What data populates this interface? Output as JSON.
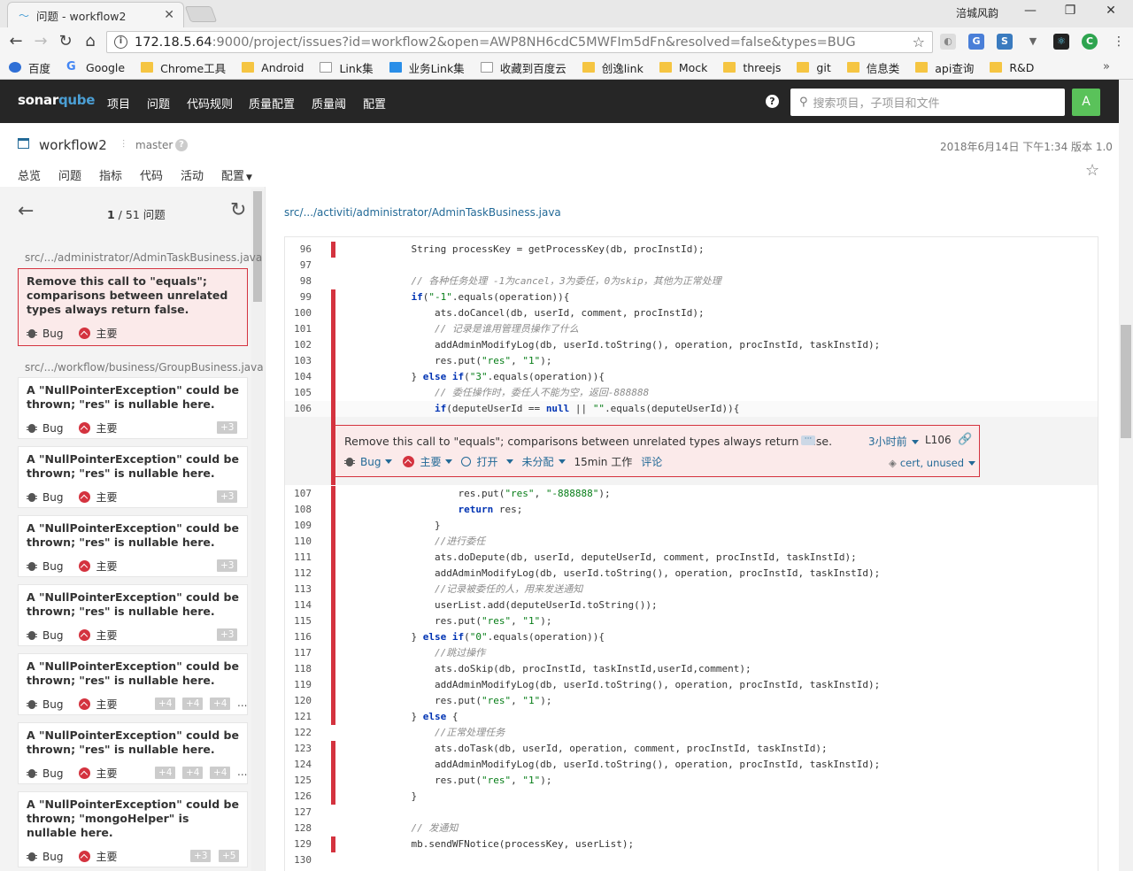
{
  "browser": {
    "tab_title": "问题 - workflow2",
    "user": "涪城风韵",
    "url_host": "172.18.5.64",
    "url_path": ":9000/project/issues?id=workflow2&open=AWP8NH6cdC5MWFIm5dFn&resolved=false&types=BUG",
    "bookmarks": [
      "百度",
      "Google",
      "Chrome工具",
      "Android",
      "Link集",
      "业务Link集",
      "收藏到百度云",
      "创逸link",
      "Mock",
      "threejs",
      "git",
      "信息类",
      "api查询",
      "R&D"
    ]
  },
  "nav": {
    "logo_a": "sonar",
    "logo_b": "qube",
    "menu": [
      "项目",
      "问题",
      "代码规则",
      "质量配置",
      "质量阈",
      "配置"
    ],
    "search_placeholder": "搜索项目，子项目和文件",
    "avatar": "A",
    "help": "?"
  },
  "project": {
    "name": "workflow2",
    "branch": "master",
    "date": "2018年6月14日 下午1:34",
    "version": "版本 1.0",
    "tabs": [
      "总览",
      "问题",
      "指标",
      "代码",
      "活动",
      "配置"
    ]
  },
  "sidebar": {
    "pager_current": "1",
    "pager_total": " / 51 问题",
    "files": [
      "src/.../administrator/AdminTaskBusiness.java",
      "src/.../workflow/business/GroupBusiness.java"
    ],
    "issues": [
      {
        "msg": "Remove this call to \"equals\"; comparisons between unrelated types always return false.",
        "type": "Bug",
        "severity": "主要",
        "locs": []
      },
      {
        "msg": "A \"NullPointerException\" could be thrown; \"res\" is nullable here.",
        "type": "Bug",
        "severity": "主要",
        "locs": [
          "+3"
        ]
      },
      {
        "msg": "A \"NullPointerException\" could be thrown; \"res\" is nullable here.",
        "type": "Bug",
        "severity": "主要",
        "locs": [
          "+3"
        ]
      },
      {
        "msg": "A \"NullPointerException\" could be thrown; \"res\" is nullable here.",
        "type": "Bug",
        "severity": "主要",
        "locs": [
          "+3"
        ]
      },
      {
        "msg": "A \"NullPointerException\" could be thrown; \"res\" is nullable here.",
        "type": "Bug",
        "severity": "主要",
        "locs": [
          "+3"
        ]
      },
      {
        "msg": "A \"NullPointerException\" could be thrown; \"res\" is nullable here.",
        "type": "Bug",
        "severity": "主要",
        "locs": [
          "+4",
          "+4",
          "+4"
        ]
      },
      {
        "msg": "A \"NullPointerException\" could be thrown; \"res\" is nullable here.",
        "type": "Bug",
        "severity": "主要",
        "locs": [
          "+4",
          "+4",
          "+4"
        ]
      },
      {
        "msg": "A \"NullPointerException\" could be thrown; \"mongoHelper\" is nullable here.",
        "type": "Bug",
        "severity": "主要",
        "locs": [
          "+3",
          "+5"
        ]
      }
    ],
    "ellipsis": "..."
  },
  "main": {
    "file_path": "src/.../activiti/administrator/AdminTaskBusiness.java",
    "issue": {
      "msg": "Remove this call to \"equals\"; comparisons between unrelated types always return false.",
      "more": "···",
      "ago": "3小时前",
      "line": "L106",
      "type": "Bug",
      "severity": "主要",
      "status": "打开",
      "assignee": "未分配",
      "effort": "15min 工作",
      "comment": "评论",
      "tags": "cert, unused"
    },
    "lines_before": [
      {
        "n": "96",
        "t": "            String processKey = getProcessKey(db, procInstId);"
      },
      {
        "n": "97",
        "t": ""
      },
      {
        "n": "98",
        "t": "            // 各种任务处理 -1为cancel，3为委任，0为skip，其他为正常处理"
      },
      {
        "n": "99",
        "t": "            if(\"-1\".equals(operation)){"
      },
      {
        "n": "100",
        "t": "                ats.doCancel(db, userId, comment, procInstId);"
      },
      {
        "n": "101",
        "t": "                // 记录是谁用管理员操作了什么"
      },
      {
        "n": "102",
        "t": "                addAdminModifyLog(db, userId.toString(), operation, procInstId, taskInstId);"
      },
      {
        "n": "103",
        "t": "                res.put(\"res\", \"1\");"
      },
      {
        "n": "104",
        "t": "            } else if(\"3\".equals(operation)){"
      },
      {
        "n": "105",
        "t": "                // 委任操作时，委任人不能为空，返回-888888"
      },
      {
        "n": "106",
        "t": "                if(deputeUserId == null || \"\".equals(deputeUserId)){"
      }
    ],
    "lines_after": [
      {
        "n": "107",
        "t": "                    res.put(\"res\", \"-888888\");"
      },
      {
        "n": "108",
        "t": "                    return res;"
      },
      {
        "n": "109",
        "t": "                }"
      },
      {
        "n": "110",
        "t": "                //进行委任"
      },
      {
        "n": "111",
        "t": "                ats.doDepute(db, userId, deputeUserId, comment, procInstId, taskInstId);"
      },
      {
        "n": "112",
        "t": "                addAdminModifyLog(db, userId.toString(), operation, procInstId, taskInstId);"
      },
      {
        "n": "113",
        "t": "                //记录被委任的人，用来发送通知"
      },
      {
        "n": "114",
        "t": "                userList.add(deputeUserId.toString());"
      },
      {
        "n": "115",
        "t": "                res.put(\"res\", \"1\");"
      },
      {
        "n": "116",
        "t": "            } else if(\"0\".equals(operation)){"
      },
      {
        "n": "117",
        "t": "                //跳过操作"
      },
      {
        "n": "118",
        "t": "                ats.doSkip(db, procInstId, taskInstId,userId,comment);"
      },
      {
        "n": "119",
        "t": "                addAdminModifyLog(db, userId.toString(), operation, procInstId, taskInstId);"
      },
      {
        "n": "120",
        "t": "                res.put(\"res\", \"1\");"
      },
      {
        "n": "121",
        "t": "            } else {"
      },
      {
        "n": "122",
        "t": "                //正常处理任务"
      },
      {
        "n": "123",
        "t": "                ats.doTask(db, userId, operation, comment, procInstId, taskInstId);"
      },
      {
        "n": "124",
        "t": "                addAdminModifyLog(db, userId.toString(), operation, procInstId, taskInstId);"
      },
      {
        "n": "125",
        "t": "                res.put(\"res\", \"1\");"
      },
      {
        "n": "126",
        "t": "            }"
      },
      {
        "n": "127",
        "t": ""
      },
      {
        "n": "128",
        "t": "            // 发通知"
      },
      {
        "n": "129",
        "t": "            mb.sendWFNotice(processKey, userList);"
      },
      {
        "n": "130",
        "t": ""
      }
    ]
  }
}
